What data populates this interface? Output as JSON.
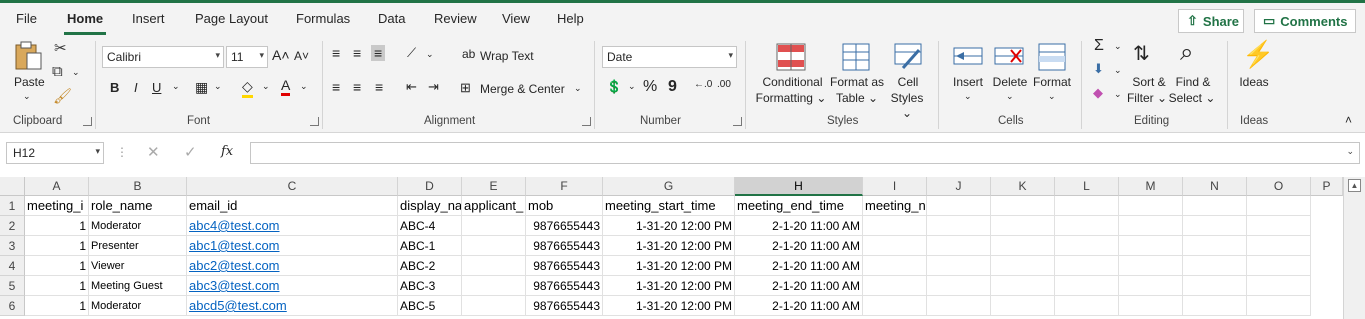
{
  "menu": {
    "tabs": [
      "File",
      "Home",
      "Insert",
      "Page Layout",
      "Formulas",
      "Data",
      "Review",
      "View",
      "Help"
    ],
    "share": "Share",
    "comments": "Comments"
  },
  "ribbon": {
    "clipboard": {
      "label": "Clipboard",
      "paste": "Paste"
    },
    "font": {
      "label": "Font",
      "name": "Calibri",
      "size": "11",
      "bold": "B",
      "italic": "I",
      "underline": "U"
    },
    "alignment": {
      "label": "Alignment",
      "wrap": "Wrap Text",
      "merge": "Merge & Center"
    },
    "number": {
      "label": "Number",
      "format": "Date",
      "percent": "%",
      "comma": "9"
    },
    "styles": {
      "label": "Styles",
      "cond1": "Conditional",
      "cond2": "Formatting",
      "fmt1": "Format as",
      "fmt2": "Table",
      "cell1": "Cell",
      "cell2": "Styles"
    },
    "cells": {
      "label": "Cells",
      "insert": "Insert",
      "delete": "Delete",
      "format": "Format"
    },
    "editing": {
      "label": "Editing",
      "sort1": "Sort &",
      "sort2": "Filter",
      "find1": "Find &",
      "find2": "Select",
      "sigma": "Σ"
    },
    "ideas": {
      "label": "Ideas",
      "btn": "Ideas"
    }
  },
  "formula_bar": {
    "namebox": "H12",
    "fx": "fx",
    "content": ""
  },
  "sheet": {
    "columns": [
      "A",
      "B",
      "C",
      "D",
      "E",
      "F",
      "G",
      "H",
      "I",
      "J",
      "K",
      "L",
      "M",
      "N",
      "O",
      "P"
    ],
    "selected_column": "H",
    "rows": [
      "1",
      "2",
      "3",
      "4",
      "5",
      "6"
    ],
    "header_row": [
      "meeting_i",
      "role_name",
      "email_id",
      "display_na",
      "applicant_",
      "mob",
      "meeting_start_time",
      "meeting_end_time",
      "meeting_name"
    ],
    "data": [
      [
        "1",
        "Moderator",
        "abc4@test.com",
        "ABC-4",
        "",
        "9876655443",
        "1-31-20 12:00 PM",
        "2-1-20 11:00 AM"
      ],
      [
        "1",
        "Presenter",
        "abc1@test.com",
        "ABC-1",
        "",
        "9876655443",
        "1-31-20 12:00 PM",
        "2-1-20 11:00 AM"
      ],
      [
        "1",
        "Viewer",
        "abc2@test.com",
        "ABC-2",
        "",
        "9876655443",
        "1-31-20 12:00 PM",
        "2-1-20 11:00 AM"
      ],
      [
        "1",
        "Meeting Guest",
        "abc3@test.com",
        "ABC-3",
        "",
        "9876655443",
        "1-31-20 12:00 PM",
        "2-1-20 11:00 AM"
      ],
      [
        "1",
        "Moderator",
        "abcd5@test.com",
        "ABC-5",
        "",
        "9876655443",
        "1-31-20 12:00 PM",
        "2-1-20 11:00 AM"
      ]
    ]
  },
  "colors": {
    "accent": "#217346",
    "link": "#0563c1"
  }
}
